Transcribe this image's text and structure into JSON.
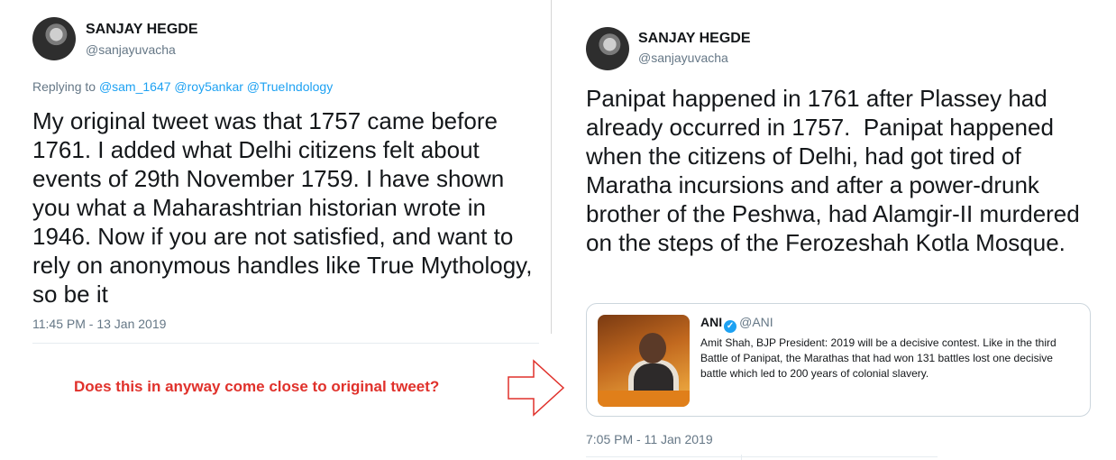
{
  "left_tweet": {
    "author_name": "SANJAY HEGDE",
    "author_handle": "@sanjayuvacha",
    "replying_prefix": "Replying to",
    "replying_mentions": [
      "@sam_1647",
      "@roy5ankar",
      "@TrueIndology"
    ],
    "text": "My original tweet was that 1757 came before 1761. I added what Delhi citizens felt about events of 29th November 1759. I have shown you what a Maharashtrian historian wrote in 1946. Now if you are not satisfied, and want to rely on anonymous handles like True Mythology, so be it",
    "timestamp": "11:45 PM - 13 Jan 2019"
  },
  "annotation": {
    "question": "Does this in anyway come close to original tweet?",
    "arrow_color": "#e0312b"
  },
  "right_tweet": {
    "author_name": "SANJAY HEGDE",
    "author_handle": "@sanjayuvacha",
    "text": "Panipat happened in 1761 after Plassey had already occurred in 1757.  Panipat happened when the citizens of Delhi, had got tired of Maratha incursions and after a power-drunk brother of the Peshwa, had Alamgir-II murdered on the steps of the Ferozeshah Kotla Mosque.",
    "timestamp": "7:05 PM - 11 Jan 2019",
    "quoted": {
      "name": "ANI",
      "verified_icon": "verified-badge-icon",
      "handle": "@ANI",
      "text": "Amit Shah, BJP President: 2019 will be a decisive contest. Like in the third Battle of Panipat, the Marathas that had won 131 battles lost one decisive battle which led to 200 years of colonial slavery."
    }
  },
  "colors": {
    "link": "#1da1f2",
    "muted": "#657786",
    "text": "#14171a",
    "annotation_red": "#e0312b"
  }
}
